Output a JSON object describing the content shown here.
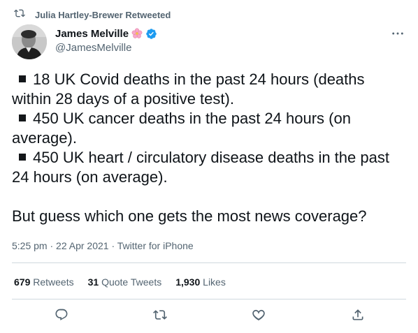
{
  "retweet": {
    "icon": "retweet-icon",
    "text": "Julia Hartley-Brewer Retweeted"
  },
  "author": {
    "display_name": "James Melville",
    "handle": "@JamesMelville",
    "badge_emoji_icon": "cherry-blossom-icon",
    "verified_icon": "verified-badge-icon",
    "verified_color": "#1d9bf0"
  },
  "tweet": {
    "lines": [
      "18 UK Covid deaths in the past 24 hours (deaths",
      "within 28 days of a positive test).",
      "450 UK cancer deaths in the past 24 hours (on",
      "average).",
      "450 UK heart / circulatory disease deaths in the past",
      "24 hours (on average).",
      "But guess which one gets the most news coverage?"
    ]
  },
  "meta": {
    "time": "5:25 pm",
    "separator": "·",
    "date": "22 Apr 2021",
    "client": "Twitter for iPhone"
  },
  "stats": [
    {
      "count": "679",
      "label": "Retweets"
    },
    {
      "count": "31",
      "label": "Quote Tweets"
    },
    {
      "count": "1,930",
      "label": "Likes"
    }
  ],
  "actions": [
    "reply-icon",
    "retweet-icon",
    "like-icon",
    "share-icon"
  ],
  "colors": {
    "text_primary": "#0f1419",
    "text_secondary": "#536471",
    "divider": "#cfd9de",
    "verified": "#1d9bf0"
  }
}
